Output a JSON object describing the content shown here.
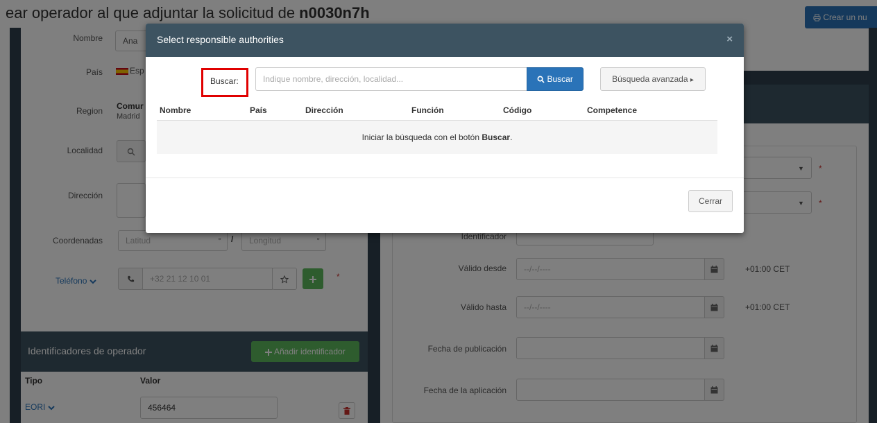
{
  "page": {
    "title_prefix": "ear operador al que adjuntar la solicitud de ",
    "title_code": "n0030n7h",
    "create_button": "Crear un nu"
  },
  "left_form": {
    "nombre_label": "Nombre",
    "nombre_value": "Ana",
    "pais_label": "País",
    "pais_value": "Esp",
    "region_label": "Region",
    "region_value_1": "Comur",
    "region_value_2": "Madrid",
    "localidad_label": "Localidad",
    "direccion_label": "Dirección",
    "coordenadas_label": "Coordenadas",
    "latitud_placeholder": "Latitud",
    "longitud_placeholder": "Longitud",
    "degree_symbol": "°",
    "coord_separator": "/",
    "telefono_label": "Teléfono",
    "telefono_placeholder": "+32 21 12 10 01",
    "required_mark": "*"
  },
  "operator_ids": {
    "title": "Identificadores de operador",
    "add_button": "Añadir identificador",
    "col_tipo": "Tipo",
    "col_valor": "Valor",
    "row_tipo": "EORI",
    "row_valor": "456464"
  },
  "right_form": {
    "identificador_label": "Identificador",
    "valido_desde_label": "Válido desde",
    "valido_desde_value": "--/--/----",
    "valido_hasta_label": "Válido hasta",
    "valido_hasta_value": "--/--/----",
    "timezone": "+01:00 CET",
    "fecha_publicacion_label": "Fecha de publicación",
    "fecha_aplicacion_label": "Fecha de la aplicación",
    "required_mark": "*"
  },
  "modal": {
    "title": "Select responsible authorities",
    "close_symbol": "×",
    "search_label": "Buscar:",
    "search_placeholder": "Indique nombre, dirección, localidad...",
    "search_button": "Buscar",
    "advanced_button": "Búsqueda avanzada",
    "advanced_caret": "▸",
    "columns": [
      "Nombre",
      "País",
      "Dirección",
      "Función",
      "Código",
      "Competence"
    ],
    "empty_prefix": "Iniciar la búsqueda con el botón ",
    "empty_bold": "Buscar",
    "empty_suffix": ".",
    "close_button": "Cerrar"
  },
  "colors": {
    "header_dark": "#3d5361",
    "primary_blue": "#2a73b8",
    "success_green": "#5cb85c",
    "highlight_red": "#e00000"
  },
  "icons": [
    "search-icon",
    "phone-icon",
    "star-icon",
    "plus-icon",
    "calendar-icon",
    "trash-icon",
    "print-icon",
    "chevron-down-icon",
    "close-icon",
    "caret-right-icon"
  ]
}
